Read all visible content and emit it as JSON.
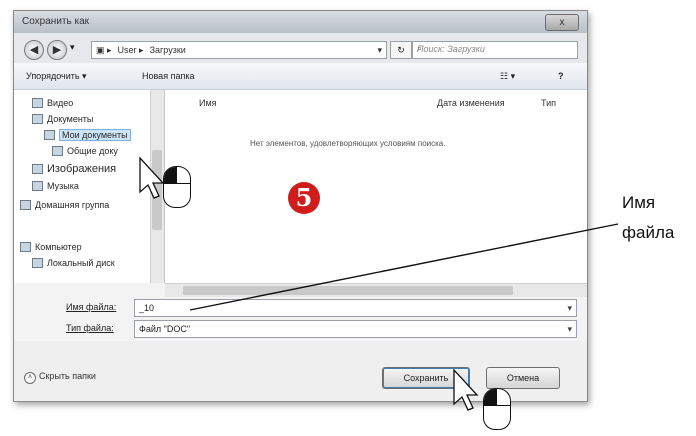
{
  "window": {
    "title": "Сохранить как",
    "close_label": "x"
  },
  "address": {
    "back_glyph": "◀",
    "forward_glyph": "▶",
    "crumbs": [
      "▣ ▸",
      "User ▸",
      "Загрузки"
    ],
    "dropdown_glyph": "▾",
    "refresh_glyph": "↻",
    "search_placeholder": "Поиск: Загрузки",
    "search_icon": "⌕"
  },
  "toolbar": {
    "organize_label": "Упорядочить ▾",
    "new_folder_label": "Новая папка",
    "view_glyph": "☷ ▾",
    "help_glyph": "?"
  },
  "nav": {
    "items": [
      {
        "label": "Видео",
        "indent": 1
      },
      {
        "label": "Документы",
        "indent": 1
      },
      {
        "label": "Мои документы",
        "indent": 2,
        "selected": true
      },
      {
        "label": "Общие доку",
        "indent": 2
      },
      {
        "label": "Изображения",
        "indent": 1
      },
      {
        "label": "Музыка",
        "indent": 1
      },
      {
        "label": "Домашняя группа",
        "indent": 0
      },
      {
        "label": "Компьютер",
        "indent": 0
      },
      {
        "label": "Локальный диск",
        "indent": 1
      }
    ]
  },
  "content": {
    "columns": [
      "Имя",
      "Дата изменения",
      "Тип"
    ],
    "empty_message": "Нет элементов, удовлетворяющих условиям поиска."
  },
  "fields": {
    "filename_label": "Имя файла:",
    "filename_value": "_10",
    "filetype_label": "Тип файла:",
    "filetype_value": "Файл \"DOC\"",
    "dropdown_glyph": "▾"
  },
  "bottom": {
    "hide_folders_label": "Скрыть папки",
    "hide_folders_glyph": "˄",
    "save_label": "Сохранить",
    "cancel_label": "Отмена"
  },
  "annotation": {
    "step_number": "5",
    "callout_line1": "Имя",
    "callout_line2": "файла"
  },
  "colors": {
    "badge": "#d11c1c",
    "selection": "#cde4f7"
  }
}
